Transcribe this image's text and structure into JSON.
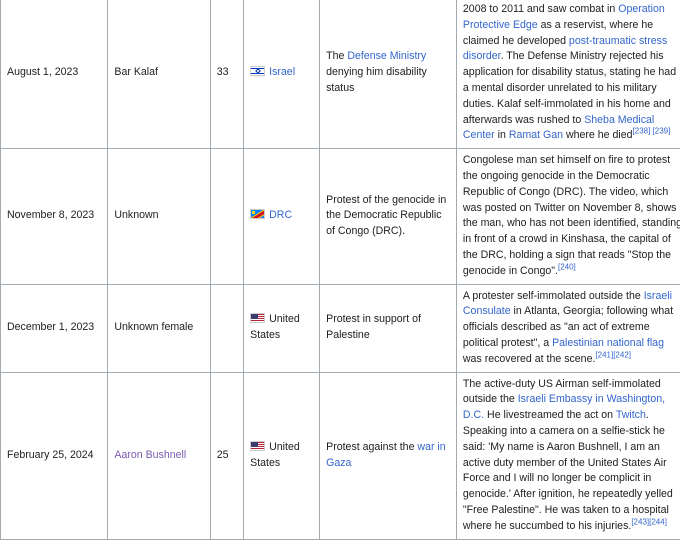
{
  "rows": [
    {
      "date": "August 1, 2023",
      "name": "Bar Kalaf",
      "age": "33",
      "country": "Israel",
      "reason": {
        "t1": "The ",
        "link1": "Defense Ministry",
        "t2": " denying him disability status"
      },
      "notes": {
        "t1": "2008 to 2011 and saw combat in ",
        "l1": "Operation Protective Edge",
        "t2": " as a reservist, where he claimed he developed ",
        "l2": "post-traumatic stress disorder",
        "t3": ". The Defense Ministry rejected his application for disability status, stating he had a mental disorder unrelated to his military duties. Kalaf self-immolated in his home and afterwards was rushed to ",
        "l3": "Sheba Medical Center",
        "t4": " in ",
        "l4": "Ramat Gan",
        "t5": " where he died",
        "refs": "[238] [239]"
      }
    },
    {
      "date": "November 8, 2023",
      "name": "Unknown",
      "age": "",
      "country": "DRC",
      "reason": "Protest of the genocide in the Democratic Republic of Congo (DRC).",
      "notes": {
        "t1": "Congolese man set himself on fire to protest the ongoing genocide in the Democratic Republic of Congo (DRC). The video, which was posted on Twitter on November 8, shows the man, who has not been identified, standing in front of a crowd in Kinshasa, the capital of the DRC, holding a sign that reads \"Stop the genocide in Congo\".",
        "refs": "[240]"
      }
    },
    {
      "date": "December 1, 2023",
      "name": "Unknown female",
      "age": "",
      "country": "United States",
      "reason": "Protest in support of Palestine",
      "notes": {
        "t1": "A protester self-immolated outside the ",
        "l1": "Israeli Consulate",
        "t2": " in Atlanta, Georgia; following what officials described as \"an act of extreme political protest\", a ",
        "l2": "Palestinian national flag",
        "t3": " was recovered at the scene.",
        "refs": "[241][242]"
      }
    },
    {
      "date": "February 25, 2024",
      "name": "Aaron Bushnell",
      "age": "25",
      "country": "United States",
      "reason": {
        "t1": "Protest against the ",
        "link1": "war in Gaza"
      },
      "notes": {
        "t1": "The active-duty US Airman self-immolated outside the ",
        "l1": "Israeli Embassy in Washington, D.C.",
        "t2": " He livestreamed the act on ",
        "l2": "Twitch",
        "t3": ". Speaking into a camera on a selfie-stick he said: 'My name is Aaron Bushnell, I am an active duty member of the United States Air Force and I will no longer be complicit in genocide.' After ignition, he repeatedly yelled \"Free Palestine\". He was taken to a hospital where he succumbed to his injuries.",
        "refs": "[243][244]"
      }
    }
  ]
}
